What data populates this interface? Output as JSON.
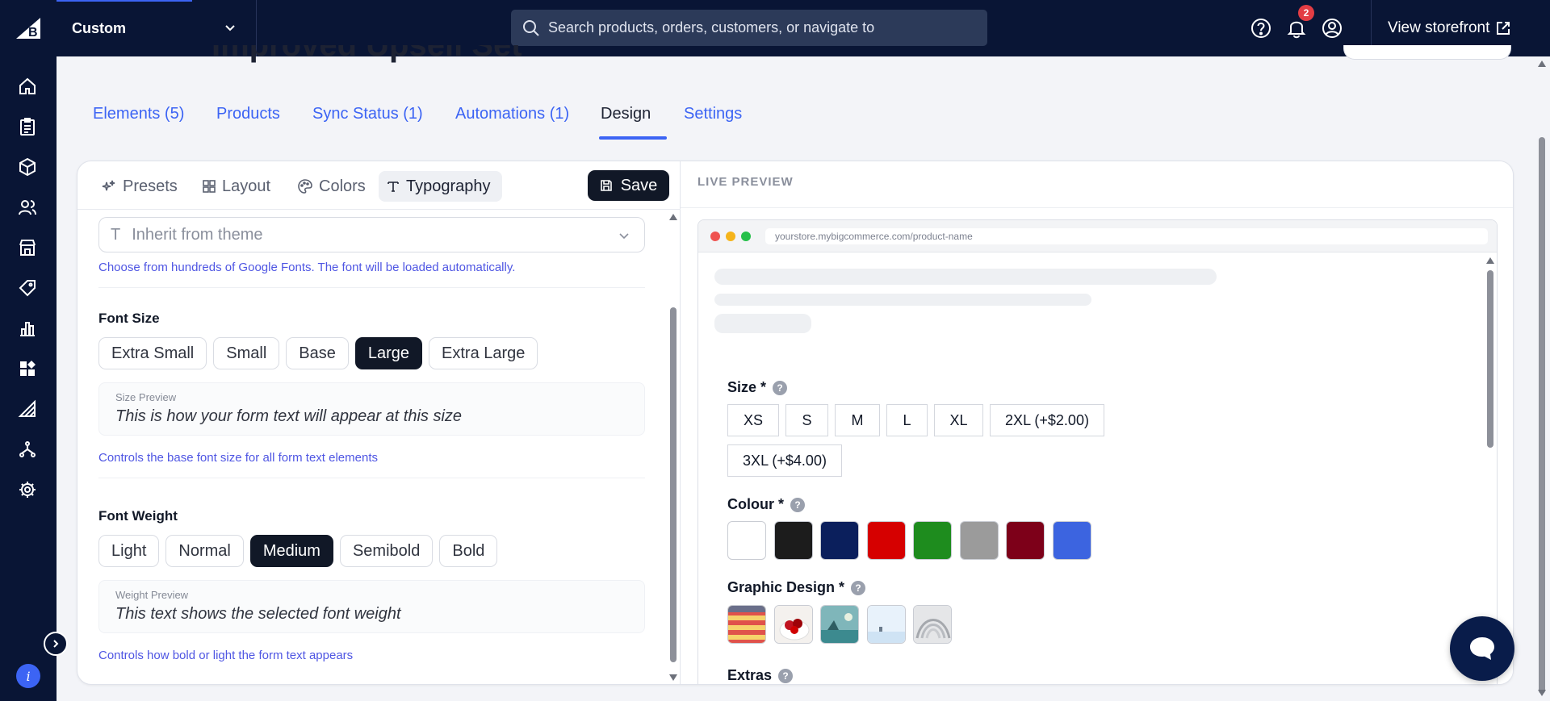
{
  "topbar": {
    "store_name": "Custom",
    "search_placeholder": "Search products, orders, customers, or navigate to",
    "notification_count": "2",
    "view_storefront": "View storefront"
  },
  "page": {
    "title": "Improved Upsell Set"
  },
  "tabs": [
    {
      "label": "Elements (5)"
    },
    {
      "label": "Products"
    },
    {
      "label": "Sync Status (1)"
    },
    {
      "label": "Automations (1)"
    },
    {
      "label": "Design",
      "active": true
    },
    {
      "label": "Settings"
    }
  ],
  "subtabs": [
    {
      "label": "Presets"
    },
    {
      "label": "Layout"
    },
    {
      "label": "Colors"
    },
    {
      "label": "Typography",
      "active": true
    }
  ],
  "save_label": "Save",
  "typography": {
    "font_family": {
      "value": "Inherit from theme",
      "help": "Choose from hundreds of Google Fonts. The font will be loaded automatically."
    },
    "font_size": {
      "title": "Font Size",
      "options": [
        "Extra Small",
        "Small",
        "Base",
        "Large",
        "Extra Large"
      ],
      "selected": "Large",
      "preview_label": "Size Preview",
      "preview_text": "This is how your form text will appear at this size",
      "help": "Controls the base font size for all form text elements"
    },
    "font_weight": {
      "title": "Font Weight",
      "options": [
        "Light",
        "Normal",
        "Medium",
        "Semibold",
        "Bold"
      ],
      "selected": "Medium",
      "preview_label": "Weight Preview",
      "preview_text": "This text shows the selected font weight",
      "help": "Controls how bold or light the form text appears"
    }
  },
  "preview": {
    "label": "LIVE PREVIEW",
    "url": "yourstore.mybigcommerce.com/product-name",
    "size": {
      "label": "Size *",
      "options": [
        "XS",
        "S",
        "M",
        "L",
        "XL",
        "2XL (+$2.00)",
        "3XL (+$4.00)"
      ]
    },
    "colour": {
      "label": "Colour *",
      "swatches": [
        "#ffffff",
        "#1c1c1c",
        "#0b1f5c",
        "#d60000",
        "#1e8c1e",
        "#9b9b9b",
        "#7d0019",
        "#3c64e0"
      ]
    },
    "graphic": {
      "label": "Graphic Design *"
    },
    "extras": {
      "label": "Extras"
    },
    "help_mark": "?"
  },
  "colors": {
    "nav_bg": "#091535",
    "accent": "#3c64f4",
    "dark_button": "#111827"
  }
}
